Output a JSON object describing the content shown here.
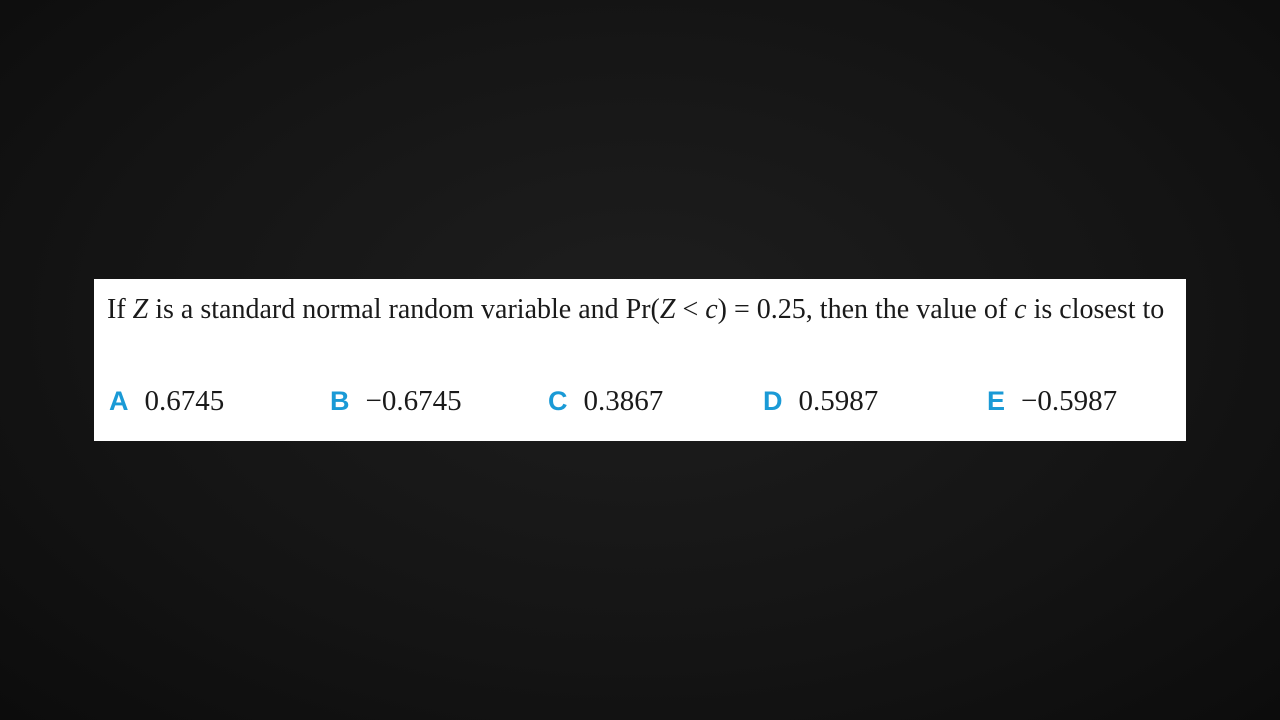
{
  "question": {
    "part1": "If ",
    "z1": "Z",
    "part2": " is a standard normal random variable and Pr(",
    "z2": "Z",
    "part3": " < ",
    "c1": "c",
    "part4": ") = 0.25, then the value of ",
    "c2": "c",
    "part5": " is closest to"
  },
  "options": [
    {
      "letter": "A",
      "value": "0.6745"
    },
    {
      "letter": "B",
      "value": "−0.6745"
    },
    {
      "letter": "C",
      "value": "0.3867"
    },
    {
      "letter": "D",
      "value": "0.5987"
    },
    {
      "letter": "E",
      "value": "−0.5987"
    }
  ],
  "colors": {
    "option_letter": "#1a9ad6",
    "card_background": "#ffffff",
    "slide_background": "#141414"
  }
}
